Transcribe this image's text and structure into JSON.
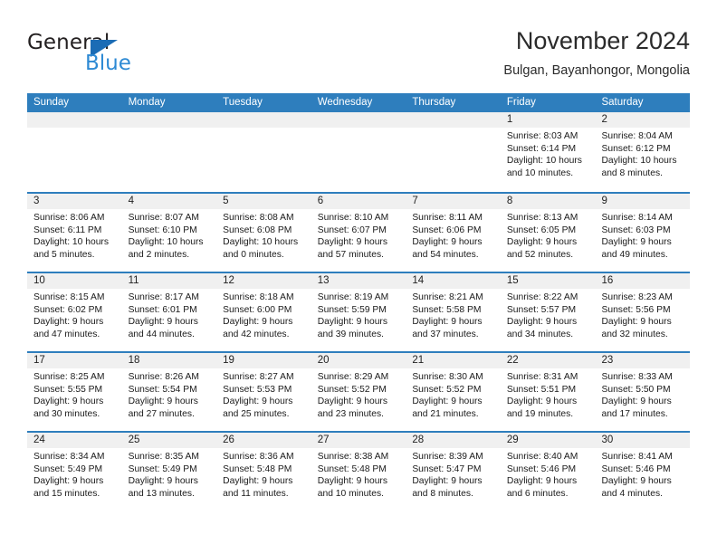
{
  "brand": {
    "name_part1": "General",
    "name_part2": "Blue",
    "triangle_color": "#1b6cb5"
  },
  "header": {
    "title": "November 2024",
    "subtitle": "Bulgan, Bayanhongor, Mongolia"
  },
  "theme": {
    "header_blue": "#2e7ebd",
    "date_band_gray": "#f0f0f0",
    "text_dark": "#1a1a1a",
    "brand_blue": "#2e8ad4"
  },
  "calendar": {
    "day_headers": [
      "Sunday",
      "Monday",
      "Tuesday",
      "Wednesday",
      "Thursday",
      "Friday",
      "Saturday"
    ],
    "weeks": [
      [
        {
          "date": "",
          "lines": []
        },
        {
          "date": "",
          "lines": []
        },
        {
          "date": "",
          "lines": []
        },
        {
          "date": "",
          "lines": []
        },
        {
          "date": "",
          "lines": []
        },
        {
          "date": "1",
          "lines": [
            "Sunrise: 8:03 AM",
            "Sunset: 6:14 PM",
            "Daylight: 10 hours",
            "and 10 minutes."
          ]
        },
        {
          "date": "2",
          "lines": [
            "Sunrise: 8:04 AM",
            "Sunset: 6:12 PM",
            "Daylight: 10 hours",
            "and 8 minutes."
          ]
        }
      ],
      [
        {
          "date": "3",
          "lines": [
            "Sunrise: 8:06 AM",
            "Sunset: 6:11 PM",
            "Daylight: 10 hours",
            "and 5 minutes."
          ]
        },
        {
          "date": "4",
          "lines": [
            "Sunrise: 8:07 AM",
            "Sunset: 6:10 PM",
            "Daylight: 10 hours",
            "and 2 minutes."
          ]
        },
        {
          "date": "5",
          "lines": [
            "Sunrise: 8:08 AM",
            "Sunset: 6:08 PM",
            "Daylight: 10 hours",
            "and 0 minutes."
          ]
        },
        {
          "date": "6",
          "lines": [
            "Sunrise: 8:10 AM",
            "Sunset: 6:07 PM",
            "Daylight: 9 hours",
            "and 57 minutes."
          ]
        },
        {
          "date": "7",
          "lines": [
            "Sunrise: 8:11 AM",
            "Sunset: 6:06 PM",
            "Daylight: 9 hours",
            "and 54 minutes."
          ]
        },
        {
          "date": "8",
          "lines": [
            "Sunrise: 8:13 AM",
            "Sunset: 6:05 PM",
            "Daylight: 9 hours",
            "and 52 minutes."
          ]
        },
        {
          "date": "9",
          "lines": [
            "Sunrise: 8:14 AM",
            "Sunset: 6:03 PM",
            "Daylight: 9 hours",
            "and 49 minutes."
          ]
        }
      ],
      [
        {
          "date": "10",
          "lines": [
            "Sunrise: 8:15 AM",
            "Sunset: 6:02 PM",
            "Daylight: 9 hours",
            "and 47 minutes."
          ]
        },
        {
          "date": "11",
          "lines": [
            "Sunrise: 8:17 AM",
            "Sunset: 6:01 PM",
            "Daylight: 9 hours",
            "and 44 minutes."
          ]
        },
        {
          "date": "12",
          "lines": [
            "Sunrise: 8:18 AM",
            "Sunset: 6:00 PM",
            "Daylight: 9 hours",
            "and 42 minutes."
          ]
        },
        {
          "date": "13",
          "lines": [
            "Sunrise: 8:19 AM",
            "Sunset: 5:59 PM",
            "Daylight: 9 hours",
            "and 39 minutes."
          ]
        },
        {
          "date": "14",
          "lines": [
            "Sunrise: 8:21 AM",
            "Sunset: 5:58 PM",
            "Daylight: 9 hours",
            "and 37 minutes."
          ]
        },
        {
          "date": "15",
          "lines": [
            "Sunrise: 8:22 AM",
            "Sunset: 5:57 PM",
            "Daylight: 9 hours",
            "and 34 minutes."
          ]
        },
        {
          "date": "16",
          "lines": [
            "Sunrise: 8:23 AM",
            "Sunset: 5:56 PM",
            "Daylight: 9 hours",
            "and 32 minutes."
          ]
        }
      ],
      [
        {
          "date": "17",
          "lines": [
            "Sunrise: 8:25 AM",
            "Sunset: 5:55 PM",
            "Daylight: 9 hours",
            "and 30 minutes."
          ]
        },
        {
          "date": "18",
          "lines": [
            "Sunrise: 8:26 AM",
            "Sunset: 5:54 PM",
            "Daylight: 9 hours",
            "and 27 minutes."
          ]
        },
        {
          "date": "19",
          "lines": [
            "Sunrise: 8:27 AM",
            "Sunset: 5:53 PM",
            "Daylight: 9 hours",
            "and 25 minutes."
          ]
        },
        {
          "date": "20",
          "lines": [
            "Sunrise: 8:29 AM",
            "Sunset: 5:52 PM",
            "Daylight: 9 hours",
            "and 23 minutes."
          ]
        },
        {
          "date": "21",
          "lines": [
            "Sunrise: 8:30 AM",
            "Sunset: 5:52 PM",
            "Daylight: 9 hours",
            "and 21 minutes."
          ]
        },
        {
          "date": "22",
          "lines": [
            "Sunrise: 8:31 AM",
            "Sunset: 5:51 PM",
            "Daylight: 9 hours",
            "and 19 minutes."
          ]
        },
        {
          "date": "23",
          "lines": [
            "Sunrise: 8:33 AM",
            "Sunset: 5:50 PM",
            "Daylight: 9 hours",
            "and 17 minutes."
          ]
        }
      ],
      [
        {
          "date": "24",
          "lines": [
            "Sunrise: 8:34 AM",
            "Sunset: 5:49 PM",
            "Daylight: 9 hours",
            "and 15 minutes."
          ]
        },
        {
          "date": "25",
          "lines": [
            "Sunrise: 8:35 AM",
            "Sunset: 5:49 PM",
            "Daylight: 9 hours",
            "and 13 minutes."
          ]
        },
        {
          "date": "26",
          "lines": [
            "Sunrise: 8:36 AM",
            "Sunset: 5:48 PM",
            "Daylight: 9 hours",
            "and 11 minutes."
          ]
        },
        {
          "date": "27",
          "lines": [
            "Sunrise: 8:38 AM",
            "Sunset: 5:48 PM",
            "Daylight: 9 hours",
            "and 10 minutes."
          ]
        },
        {
          "date": "28",
          "lines": [
            "Sunrise: 8:39 AM",
            "Sunset: 5:47 PM",
            "Daylight: 9 hours",
            "and 8 minutes."
          ]
        },
        {
          "date": "29",
          "lines": [
            "Sunrise: 8:40 AM",
            "Sunset: 5:46 PM",
            "Daylight: 9 hours",
            "and 6 minutes."
          ]
        },
        {
          "date": "30",
          "lines": [
            "Sunrise: 8:41 AM",
            "Sunset: 5:46 PM",
            "Daylight: 9 hours",
            "and 4 minutes."
          ]
        }
      ]
    ]
  }
}
